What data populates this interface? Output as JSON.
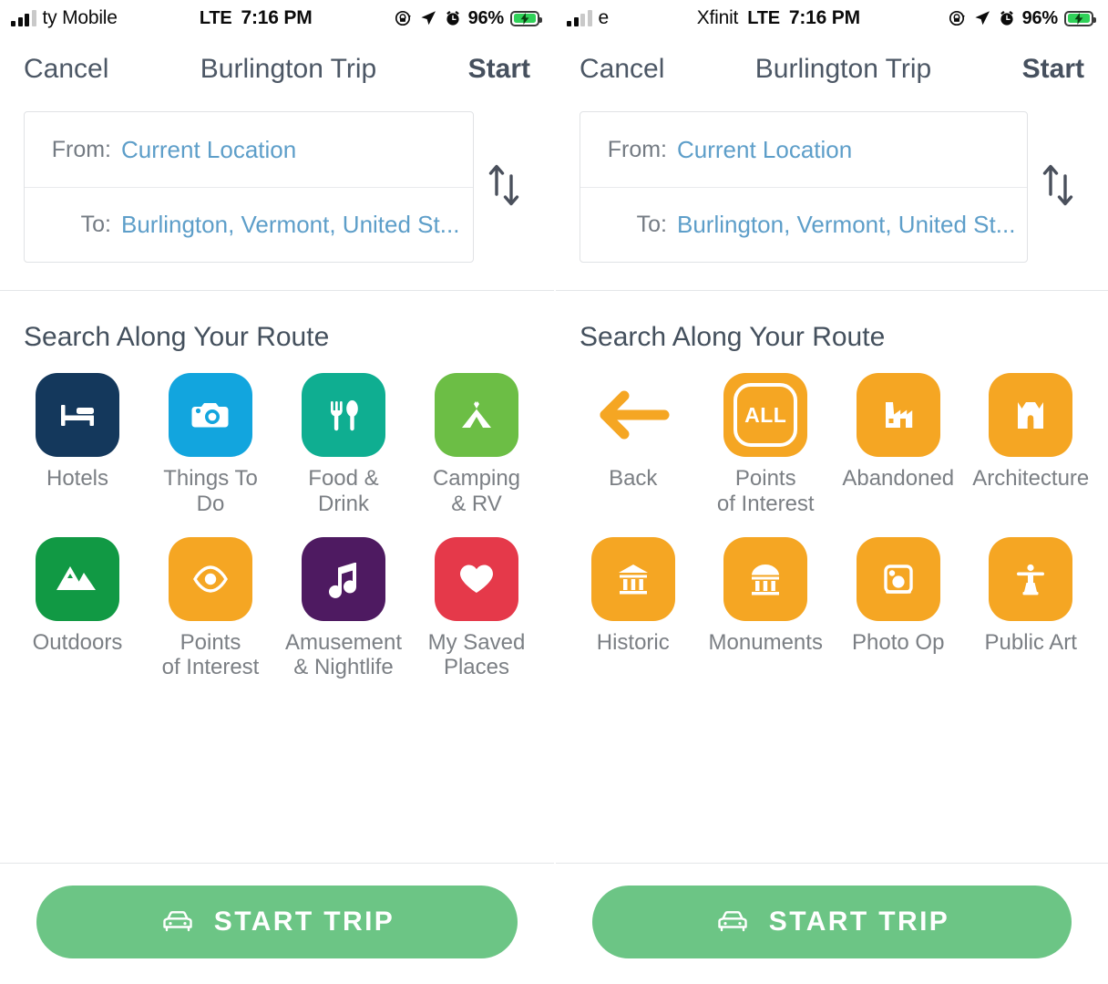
{
  "screens": [
    {
      "status": {
        "carrier_visible": "ty Mobile",
        "carrier_faded_prefix": "",
        "network": "LTE",
        "time": "7:16 PM",
        "battery_pct": "96%",
        "signal_bars_active": 3,
        "icons": [
          "orientation-lock-icon",
          "location-arrow-icon",
          "alarm-clock-icon",
          "battery-charging-icon"
        ]
      },
      "nav": {
        "cancel_label": "Cancel",
        "title": "Burlington Trip",
        "start_label": "Start"
      },
      "route": {
        "from_label": "From:",
        "from_value": "Current Location",
        "to_label": "To:",
        "to_value": "Burlington, Vermont, United St...",
        "swap_icon": "swap-vertical-icon"
      },
      "section_title": "Search Along Your Route",
      "tiles": [
        {
          "label": "Hotels",
          "icon": "bed-icon",
          "color": "#14385c"
        },
        {
          "label": "Things To Do",
          "icon": "camera-icon",
          "color": "#12a5de"
        },
        {
          "label": "Food & Drink",
          "icon": "fork-spoon-icon",
          "color": "#0fae91"
        },
        {
          "label": "Camping\n& RV",
          "icon": "tent-icon",
          "color": "#6cbe45"
        },
        {
          "label": "Outdoors",
          "icon": "mountains-icon",
          "color": "#119944"
        },
        {
          "label": "Points\nof Interest",
          "icon": "eye-icon",
          "color": "#f5a623"
        },
        {
          "label": "Amusement\n& Nightlife",
          "icon": "music-note-icon",
          "color": "#4e1a61"
        },
        {
          "label": "My Saved\nPlaces",
          "icon": "heart-icon",
          "color": "#e5394a"
        }
      ],
      "footer": {
        "start_trip_label": "START TRIP",
        "car_icon": "car-icon",
        "button_color": "#6cc585"
      }
    },
    {
      "status": {
        "carrier_visible": "e",
        "carrier_faded_prefix": "Xfinit",
        "network": "LTE",
        "time": "7:16 PM",
        "battery_pct": "96%",
        "signal_bars_active": 2,
        "icons": [
          "orientation-lock-icon",
          "location-arrow-icon",
          "alarm-clock-icon",
          "battery-charging-icon"
        ]
      },
      "nav": {
        "cancel_label": "Cancel",
        "title": "Burlington Trip",
        "start_label": "Start"
      },
      "route": {
        "from_label": "From:",
        "from_value": "Current Location",
        "to_label": "To:",
        "to_value": "Burlington, Vermont, United St...",
        "swap_icon": "swap-vertical-icon"
      },
      "section_title": "Search Along Your Route",
      "tiles": [
        {
          "label": "Back",
          "icon": "arrow-left-icon",
          "color": "none",
          "plain": true
        },
        {
          "label": "Points\nof Interest",
          "icon": "all-badge-icon",
          "color": "#f5a623",
          "badge_text": "ALL"
        },
        {
          "label": "Abandoned",
          "icon": "factory-icon",
          "color": "#f5a623"
        },
        {
          "label": "Architecture",
          "icon": "castle-icon",
          "color": "#f5a623"
        },
        {
          "label": "Historic",
          "icon": "bank-columns-icon",
          "color": "#f5a623"
        },
        {
          "label": "Monuments",
          "icon": "dome-monument-icon",
          "color": "#f5a623"
        },
        {
          "label": "Photo Op",
          "icon": "instant-camera-icon",
          "color": "#f5a623"
        },
        {
          "label": "Public Art",
          "icon": "statue-icon",
          "color": "#f5a623"
        }
      ],
      "footer": {
        "start_trip_label": "START TRIP",
        "car_icon": "car-icon",
        "button_color": "#6cc585"
      }
    }
  ]
}
